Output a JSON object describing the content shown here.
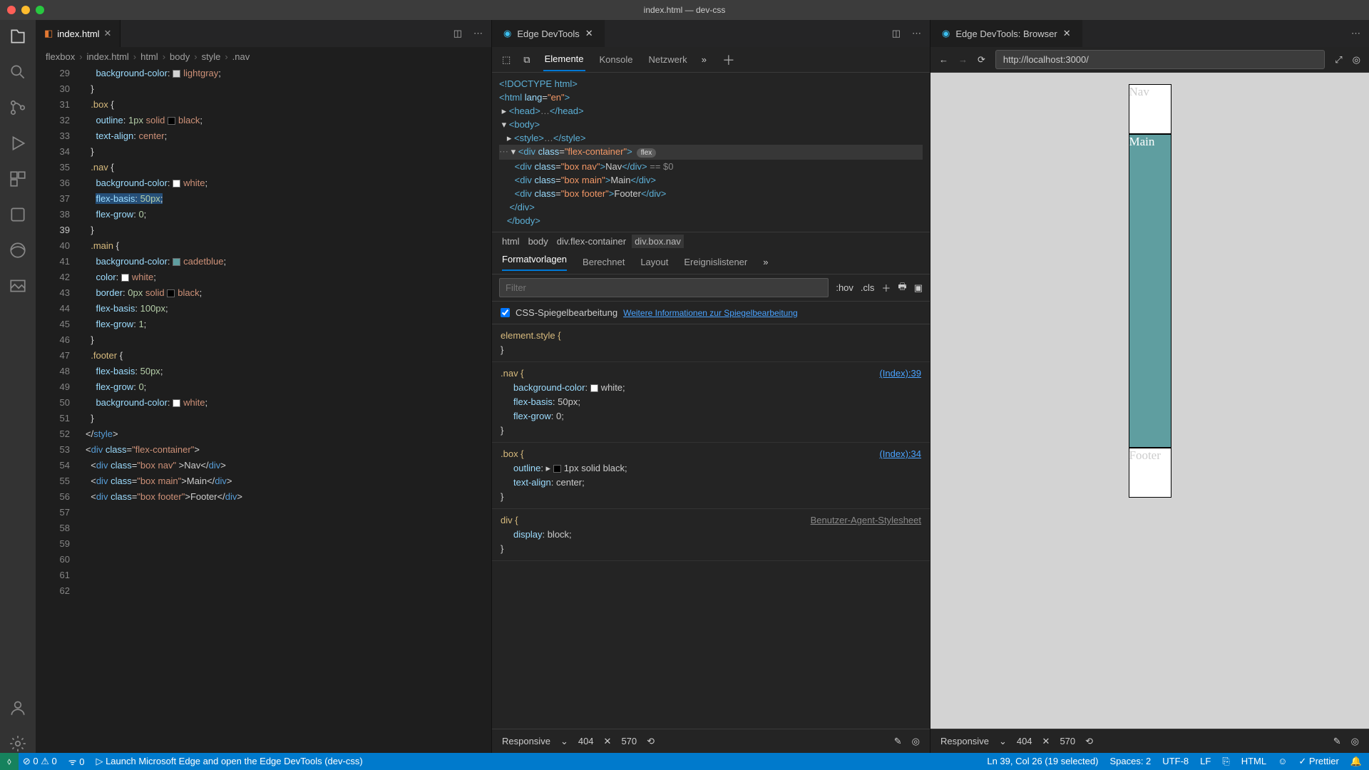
{
  "window_title": "index.html — dev-css",
  "editor": {
    "tab_filename": "index.html",
    "breadcrumb": [
      "flexbox",
      "index.html",
      "html",
      "body",
      "style",
      ".nav"
    ],
    "line_start": 29,
    "current_line": 39,
    "lines": [
      {
        "n": 29,
        "seg": [
          [
            "    ",
            "pun"
          ],
          [
            "background-color",
            "prop"
          ],
          [
            ": ",
            "pun"
          ],
          [
            "lightgray",
            "val",
            {
              "sw": "#d3d3d3"
            }
          ],
          [
            ";",
            "pun"
          ]
        ]
      },
      {
        "n": 30,
        "seg": [
          [
            "  }",
            "pun"
          ]
        ]
      },
      {
        "n": 31,
        "seg": [
          [
            "",
            ""
          ]
        ]
      },
      {
        "n": 32,
        "seg": [
          [
            "  ",
            "pun"
          ],
          [
            ".box",
            "sel"
          ],
          [
            " {",
            "pun"
          ]
        ]
      },
      {
        "n": 33,
        "seg": [
          [
            "    ",
            "pun"
          ],
          [
            "outline",
            "prop"
          ],
          [
            ": ",
            "pun"
          ],
          [
            "1px",
            "num"
          ],
          [
            " ",
            "pun"
          ],
          [
            "solid",
            "val"
          ],
          [
            " ",
            "pun"
          ],
          [
            "black",
            "val",
            {
              "sw": "#000"
            }
          ],
          [
            ";",
            "pun"
          ]
        ]
      },
      {
        "n": 34,
        "seg": [
          [
            "    ",
            "pun"
          ],
          [
            "text-align",
            "prop"
          ],
          [
            ": ",
            "pun"
          ],
          [
            "center",
            "val"
          ],
          [
            ";",
            "pun"
          ]
        ]
      },
      {
        "n": 35,
        "seg": [
          [
            "  }",
            "pun"
          ]
        ]
      },
      {
        "n": 36,
        "seg": [
          [
            "",
            ""
          ]
        ]
      },
      {
        "n": 37,
        "seg": [
          [
            "  ",
            "pun"
          ],
          [
            ".nav",
            "sel"
          ],
          [
            " {",
            "pun"
          ]
        ]
      },
      {
        "n": 38,
        "seg": [
          [
            "    ",
            "pun"
          ],
          [
            "background-color",
            "prop"
          ],
          [
            ": ",
            "pun"
          ],
          [
            "white",
            "val",
            {
              "sw": "#fff"
            }
          ],
          [
            ";",
            "pun"
          ]
        ]
      },
      {
        "n": 39,
        "seg": [
          [
            "    ",
            "pun"
          ],
          [
            "flex-basis",
            "prop",
            {
              "sel": true
            }
          ],
          [
            ": ",
            "pun",
            {
              "sel": true
            }
          ],
          [
            "50px",
            "num",
            {
              "sel": true
            }
          ],
          [
            ";",
            "pun",
            {
              "sel": true
            }
          ]
        ]
      },
      {
        "n": 40,
        "seg": [
          [
            "    ",
            "pun"
          ],
          [
            "flex-grow",
            "prop"
          ],
          [
            ": ",
            "pun"
          ],
          [
            "0",
            "num"
          ],
          [
            ";",
            "pun"
          ]
        ]
      },
      {
        "n": 41,
        "seg": [
          [
            "  }",
            "pun"
          ]
        ]
      },
      {
        "n": 42,
        "seg": [
          [
            "",
            ""
          ]
        ]
      },
      {
        "n": 43,
        "seg": [
          [
            "  ",
            "pun"
          ],
          [
            ".main",
            "sel"
          ],
          [
            " {",
            "pun"
          ]
        ]
      },
      {
        "n": 44,
        "seg": [
          [
            "    ",
            "pun"
          ],
          [
            "background-color",
            "prop"
          ],
          [
            ": ",
            "pun"
          ],
          [
            "cadetblue",
            "val",
            {
              "sw": "#5f9ea0"
            }
          ],
          [
            ";",
            "pun"
          ]
        ]
      },
      {
        "n": 45,
        "seg": [
          [
            "    ",
            "pun"
          ],
          [
            "color",
            "prop"
          ],
          [
            ": ",
            "pun"
          ],
          [
            "white",
            "val",
            {
              "sw": "#fff"
            }
          ],
          [
            ";",
            "pun"
          ]
        ]
      },
      {
        "n": 46,
        "seg": [
          [
            "    ",
            "pun"
          ],
          [
            "border",
            "prop"
          ],
          [
            ": ",
            "pun"
          ],
          [
            "0px",
            "num"
          ],
          [
            " ",
            "pun"
          ],
          [
            "solid",
            "val"
          ],
          [
            " ",
            "pun"
          ],
          [
            "black",
            "val",
            {
              "sw": "#000"
            }
          ],
          [
            ";",
            "pun"
          ]
        ]
      },
      {
        "n": 47,
        "seg": [
          [
            "    ",
            "pun"
          ],
          [
            "flex-basis",
            "prop"
          ],
          [
            ": ",
            "pun"
          ],
          [
            "100px",
            "num"
          ],
          [
            ";",
            "pun"
          ]
        ]
      },
      {
        "n": 48,
        "seg": [
          [
            "    ",
            "pun"
          ],
          [
            "flex-grow",
            "prop"
          ],
          [
            ": ",
            "pun"
          ],
          [
            "1",
            "num"
          ],
          [
            ";",
            "pun"
          ]
        ]
      },
      {
        "n": 49,
        "seg": [
          [
            "  }",
            "pun"
          ]
        ]
      },
      {
        "n": 50,
        "seg": [
          [
            "",
            ""
          ]
        ]
      },
      {
        "n": 51,
        "seg": [
          [
            "  ",
            "pun"
          ],
          [
            ".footer",
            "sel"
          ],
          [
            " {",
            "pun"
          ]
        ]
      },
      {
        "n": 52,
        "seg": [
          [
            "    ",
            "pun"
          ],
          [
            "flex-basis",
            "prop"
          ],
          [
            ": ",
            "pun"
          ],
          [
            "50px",
            "num"
          ],
          [
            ";",
            "pun"
          ]
        ]
      },
      {
        "n": 53,
        "seg": [
          [
            "    ",
            "pun"
          ],
          [
            "flex-grow",
            "prop"
          ],
          [
            ": ",
            "pun"
          ],
          [
            "0",
            "num"
          ],
          [
            ";",
            "pun"
          ]
        ]
      },
      {
        "n": 54,
        "seg": [
          [
            "    ",
            "pun"
          ],
          [
            "background-color",
            "prop"
          ],
          [
            ": ",
            "pun"
          ],
          [
            "white",
            "val",
            {
              "sw": "#fff"
            }
          ],
          [
            ";",
            "pun"
          ]
        ]
      },
      {
        "n": 55,
        "seg": [
          [
            "",
            ""
          ]
        ]
      },
      {
        "n": 56,
        "seg": [
          [
            "  }",
            "pun"
          ]
        ]
      },
      {
        "n": 57,
        "seg": [
          [
            "</",
            "pun"
          ],
          [
            "style",
            "tag"
          ],
          [
            ">",
            "pun"
          ]
        ]
      },
      {
        "n": 58,
        "seg": [
          [
            "",
            ""
          ]
        ]
      },
      {
        "n": 59,
        "seg": [
          [
            "<",
            "pun"
          ],
          [
            "div",
            "tag"
          ],
          [
            " ",
            "pun"
          ],
          [
            "class",
            "attr"
          ],
          [
            "=",
            "pun"
          ],
          [
            "\"flex-container\"",
            "str"
          ],
          [
            ">",
            "pun"
          ]
        ]
      },
      {
        "n": 60,
        "seg": [
          [
            "  <",
            "pun"
          ],
          [
            "div",
            "tag"
          ],
          [
            " ",
            "pun"
          ],
          [
            "class",
            "attr"
          ],
          [
            "=",
            "pun"
          ],
          [
            "\"box nav\"",
            "str"
          ],
          [
            " >",
            "pun"
          ],
          [
            "Nav",
            "tx"
          ],
          [
            "</",
            "pun"
          ],
          [
            "div",
            "tag"
          ],
          [
            ">",
            "pun"
          ]
        ]
      },
      {
        "n": 61,
        "seg": [
          [
            "  <",
            "pun"
          ],
          [
            "div",
            "tag"
          ],
          [
            " ",
            "pun"
          ],
          [
            "class",
            "attr"
          ],
          [
            "=",
            "pun"
          ],
          [
            "\"box main\"",
            "str"
          ],
          [
            ">",
            "pun"
          ],
          [
            "Main",
            "tx"
          ],
          [
            "</",
            "pun"
          ],
          [
            "div",
            "tag"
          ],
          [
            ">",
            "pun"
          ]
        ]
      },
      {
        "n": 62,
        "seg": [
          [
            "  <",
            "pun"
          ],
          [
            "div",
            "tag"
          ],
          [
            " ",
            "pun"
          ],
          [
            "class",
            "attr"
          ],
          [
            "=",
            "pun"
          ],
          [
            "\"box footer\"",
            "str"
          ],
          [
            ">",
            "pun"
          ],
          [
            "Footer",
            "tx"
          ],
          [
            "</",
            "pun"
          ],
          [
            "div",
            "tag"
          ],
          [
            ">",
            "pun"
          ]
        ]
      }
    ]
  },
  "devtools": {
    "tab_label": "Edge DevTools",
    "panels": [
      "Elemente",
      "Konsole",
      "Netzwerk"
    ],
    "active_panel": "Elemente",
    "dom_crumbs": [
      "html",
      "body",
      "div.flex-container",
      "div.box.nav"
    ],
    "styles_tabs": [
      "Formatvorlagen",
      "Berechnet",
      "Layout",
      "Ereignislistener"
    ],
    "filter_placeholder": "Filter",
    "hov": ":hov",
    "cls": ".cls",
    "mirror_label": "CSS-Spiegelbearbeitung",
    "mirror_link": "Weitere Informationen zur Spiegelbearbeitung",
    "rules": [
      {
        "sel": "element.style {",
        "src": "",
        "body": []
      },
      {
        "sel": ".nav {",
        "src": "(Index):39",
        "link": true,
        "body": [
          [
            "background-color",
            ": ",
            "white",
            ";",
            "#fff"
          ],
          [
            "flex-basis",
            ": ",
            "50px",
            ";"
          ],
          [
            "flex-grow",
            ": ",
            "0",
            ";"
          ]
        ]
      },
      {
        "sel": ".box {",
        "src": "(Index):34",
        "link": true,
        "body": [
          [
            "outline",
            ": ▸ ",
            "1px solid",
            " ",
            "black",
            ";",
            "#000"
          ],
          [
            "text-align",
            ": ",
            "center",
            ";"
          ]
        ]
      },
      {
        "sel": "div {",
        "src": "Benutzer-Agent-Stylesheet",
        "body": [
          [
            "display",
            ": ",
            "block",
            ";"
          ]
        ]
      }
    ],
    "device": {
      "mode": "Responsive",
      "w": "404",
      "h": "570"
    }
  },
  "browser": {
    "tab_label": "Edge DevTools: Browser",
    "url": "http://localhost:3000/",
    "sim": {
      "nav": "Nav",
      "main": "Main",
      "footer": "Footer"
    }
  },
  "status": {
    "errors": "0",
    "warnings": "0",
    "port": "0",
    "launch": "Launch Microsoft Edge and open the Edge DevTools (dev-css)",
    "selection": "Ln 39, Col 26 (19 selected)",
    "spaces": "Spaces: 2",
    "enc": "UTF-8",
    "eol": "LF",
    "lang": "HTML",
    "prettier": "Prettier"
  }
}
